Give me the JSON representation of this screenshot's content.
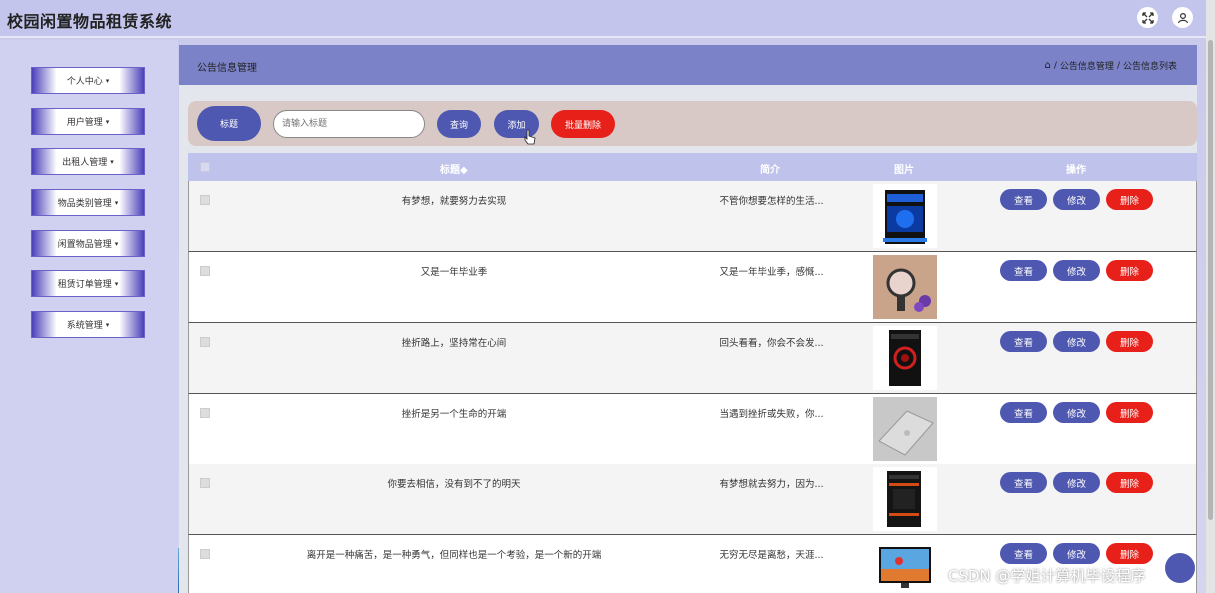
{
  "app": {
    "title": "校园闲置物品租赁系统"
  },
  "topbar": {
    "fullscreen_icon": "expand-icon",
    "user_icon": "user-icon"
  },
  "sidebar": {
    "items": [
      {
        "label": "个人中心"
      },
      {
        "label": "用户管理"
      },
      {
        "label": "出租人管理"
      },
      {
        "label": "物品类别管理"
      },
      {
        "label": "闲置物品管理"
      },
      {
        "label": "租赁订单管理"
      },
      {
        "label": "系统管理"
      }
    ],
    "caret": "▾"
  },
  "header": {
    "page_title": "公告信息管理",
    "breadcrumb": [
      "公告信息管理",
      "公告信息列表"
    ],
    "separator": "/"
  },
  "search": {
    "label": "标题",
    "placeholder": "请输入标题",
    "query_label": "查询",
    "add_label": "添加",
    "batch_delete_label": "批量删除"
  },
  "table": {
    "columns": [
      "标题◆",
      "简介",
      "图片",
      "操作"
    ],
    "actions": {
      "view": "查看",
      "edit": "修改",
      "delete": "删除"
    },
    "rows": [
      {
        "title": "有梦想，就要努力去实现",
        "intro": "不管你想要怎样的生活...",
        "image": "pc-case-blue"
      },
      {
        "title": "又是一年毕业季",
        "intro": "又是一年毕业季，感慨...",
        "image": "watch-flowers"
      },
      {
        "title": "挫折路上，坚持常在心间",
        "intro": "回头看看，你会不会发...",
        "image": "pc-case-red"
      },
      {
        "title": "挫折是另一个生命的开端",
        "intro": "当遇到挫折或失败，你...",
        "image": "laptop-silver"
      },
      {
        "title": "你要去相信，没有到不了的明天",
        "intro": "有梦想就去努力，因为...",
        "image": "pc-case-orange"
      },
      {
        "title": "离开是一种痛苦，是一种勇气，但同样也是一个考验，是一个新的开端",
        "intro": "无穷无尽是离愁，天涯...",
        "image": "tv-balloon"
      }
    ]
  },
  "watermark": "CSDN @学姐计算机毕设程序",
  "colors": {
    "primary": "#4f58b0",
    "danger": "#e8201a",
    "header": "#7b82c8",
    "topbar": "#c3c5ec"
  }
}
